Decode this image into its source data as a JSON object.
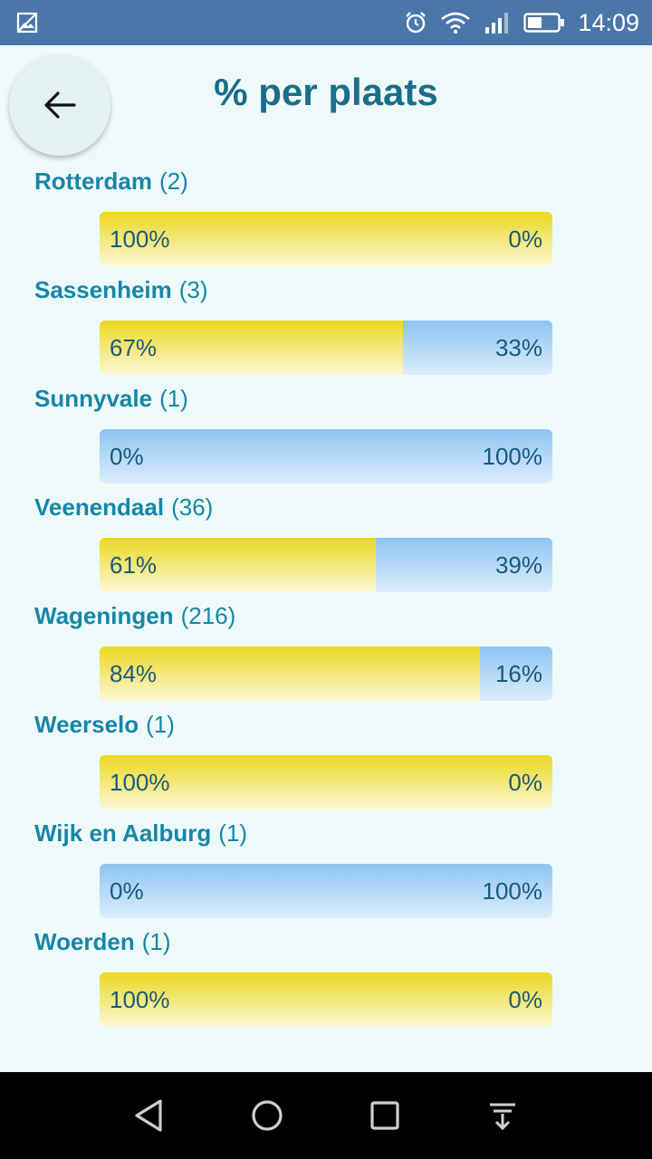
{
  "status_bar": {
    "time": "14:09",
    "icons": [
      "image-icon",
      "alarm-icon",
      "wifi-icon",
      "signal-icon",
      "battery-icon"
    ]
  },
  "header": {
    "title": "% per plaats",
    "back_icon": "arrow-left-icon"
  },
  "colors": {
    "accent_text": "#1686a8",
    "yes_fill": "#ecd820",
    "no_fill": "#8cc4f2"
  },
  "items": [
    {
      "name": "",
      "count": "",
      "left": "100%",
      "right": "0%",
      "share": 1.0
    },
    {
      "name": "Rotterdam",
      "count": "(2)",
      "left": "100%",
      "right": "0%",
      "share": 1.0
    },
    {
      "name": "Sassenheim",
      "count": "(3)",
      "left": "67%",
      "right": "33%",
      "share": 0.67
    },
    {
      "name": "Sunnyvale",
      "count": "(1)",
      "left": "0%",
      "right": "100%",
      "share": 0.0
    },
    {
      "name": "Veenendaal",
      "count": "(36)",
      "left": "61%",
      "right": "39%",
      "share": 0.61
    },
    {
      "name": "Wageningen",
      "count": "(216)",
      "left": "84%",
      "right": "16%",
      "share": 0.84
    },
    {
      "name": "Weerselo",
      "count": "(1)",
      "left": "100%",
      "right": "0%",
      "share": 1.0
    },
    {
      "name": "Wijk en Aalburg",
      "count": "(1)",
      "left": "0%",
      "right": "100%",
      "share": 0.0
    },
    {
      "name": "Woerden",
      "count": "(1)",
      "left": "100%",
      "right": "0%",
      "share": 1.0
    }
  ],
  "nav_bar": {
    "icons": [
      "back-triangle-icon",
      "home-circle-icon",
      "recents-square-icon",
      "notifications-pull-icon"
    ]
  }
}
